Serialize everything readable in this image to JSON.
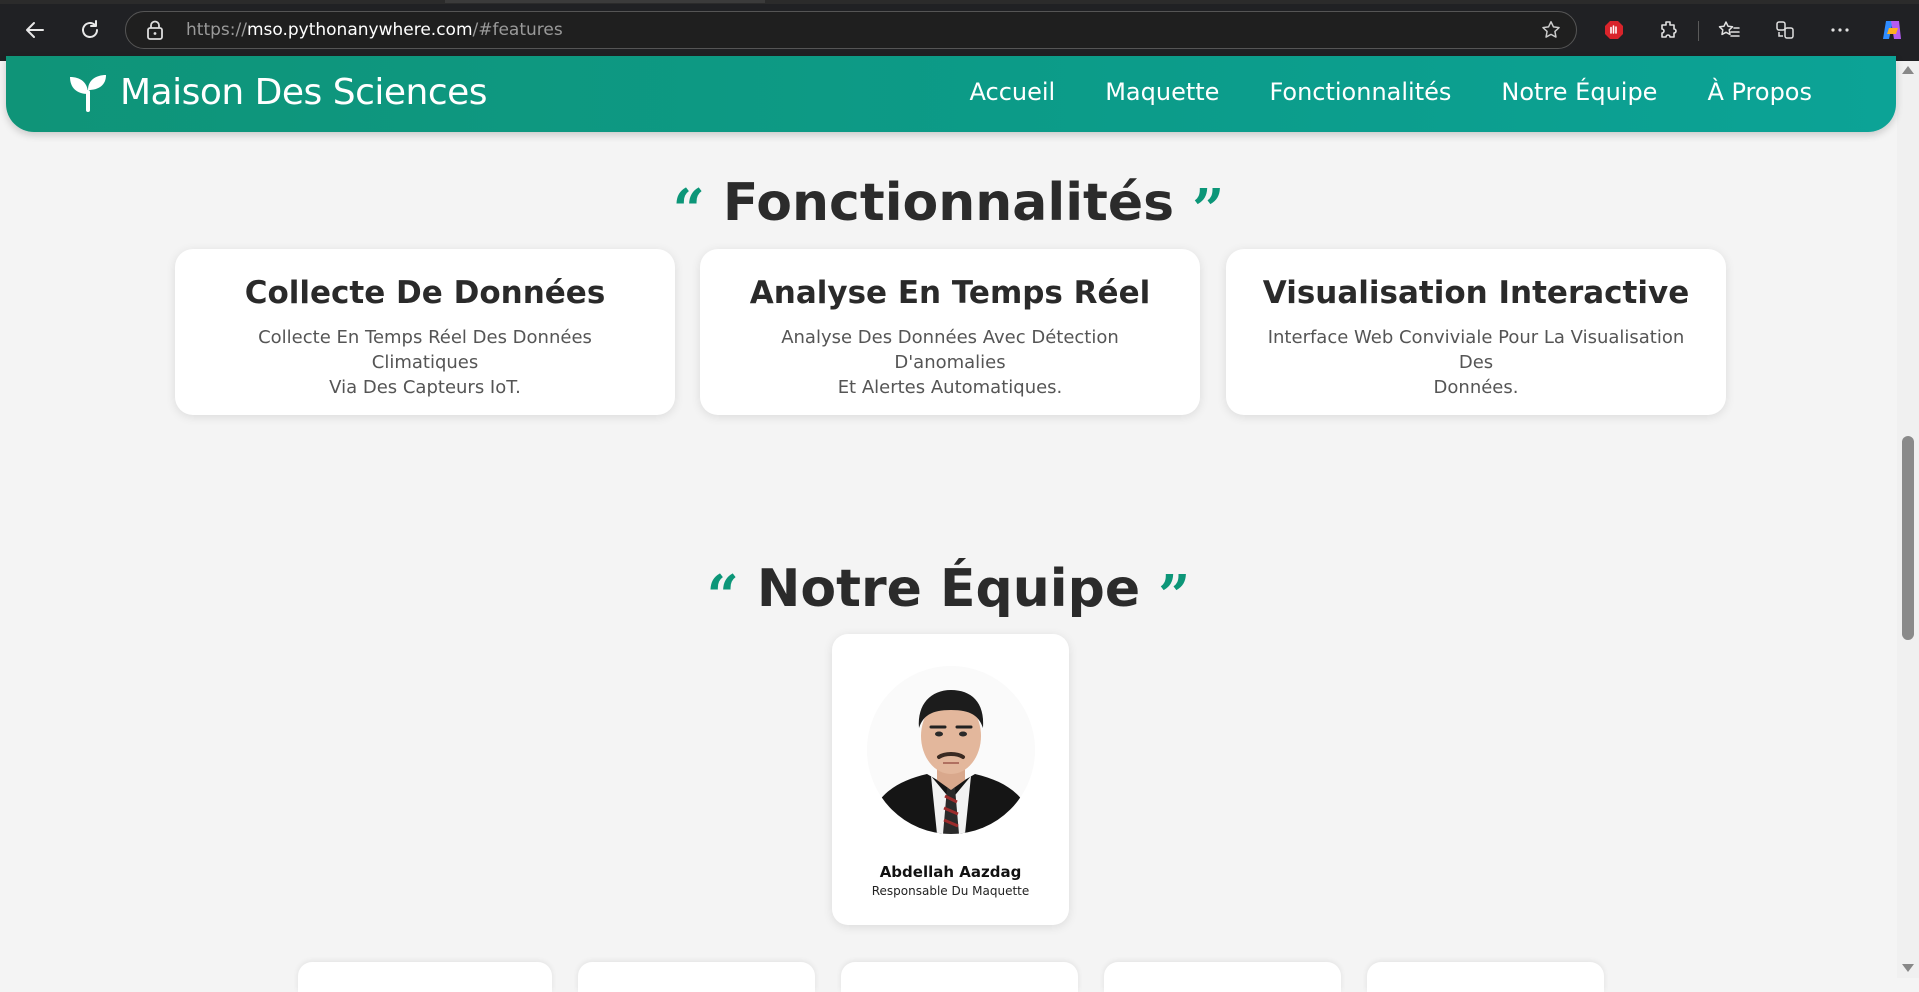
{
  "browser": {
    "url_scheme": "https://",
    "url_host": "mso.pythonanywhere.com",
    "url_path": "/#features",
    "icons": [
      "back-arrow-icon",
      "reload-icon",
      "lock-icon",
      "star-icon",
      "adblock-icon",
      "extensions-icon",
      "favorites-icon",
      "collections-icon",
      "more-icon",
      "copilot-icon"
    ]
  },
  "navbar": {
    "brand": "Maison Des Sciences",
    "items": [
      "Accueil",
      "Maquette",
      "Fonctionnalités",
      "Notre Équipe",
      "À Propos"
    ]
  },
  "features": {
    "title": "Fonctionnalités",
    "cards": [
      {
        "title": "Collecte De Données",
        "desc_line1": "Collecte En Temps Réel Des Données Climatiques",
        "desc_line2": "Via Des Capteurs IoT."
      },
      {
        "title": "Analyse En Temps Réel",
        "desc_line1": "Analyse Des Données Avec Détection D'anomalies",
        "desc_line2": "Et Alertes Automatiques."
      },
      {
        "title": "Visualisation Interactive",
        "desc_line1": "Interface Web Conviviale Pour La Visualisation Des",
        "desc_line2": "Données."
      }
    ]
  },
  "team": {
    "title": "Notre Équipe",
    "lead": {
      "name": "Abdellah Aazdag",
      "role": "Responsable Du Maquette"
    }
  },
  "colors": {
    "accent": "#0c9678",
    "navbar": "#0d9a84",
    "background": "#f4f4f4"
  }
}
